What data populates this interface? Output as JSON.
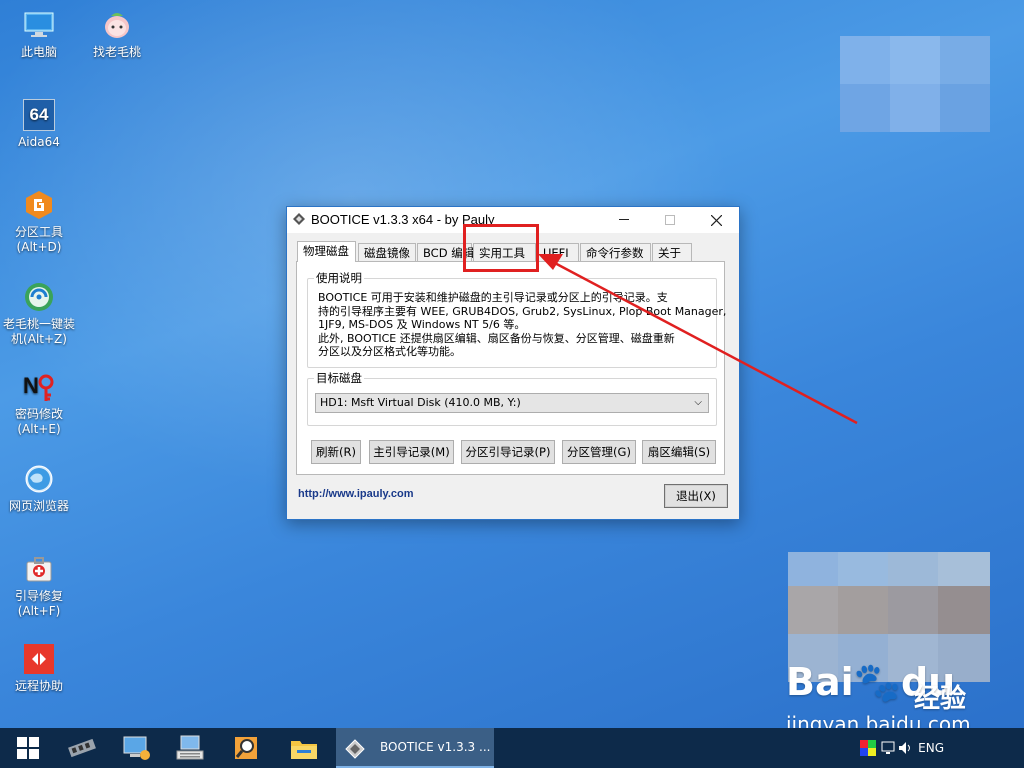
{
  "desktop": {
    "icons": [
      {
        "label": "此电脑",
        "icon": "this-pc-icon"
      },
      {
        "label": "找老毛桃",
        "icon": "peach-icon"
      },
      {
        "label": "Aida64",
        "icon": "aida64-icon",
        "glyph": "64"
      },
      {
        "label": "分区工具\n(Alt+D)",
        "icon": "partition-tool-icon"
      },
      {
        "label": "老毛桃一键装\n机(Alt+Z)",
        "icon": "one-click-install-icon"
      },
      {
        "label": "密码修改\n(Alt+E)",
        "icon": "password-change-icon"
      },
      {
        "label": "网页浏览器",
        "icon": "web-browser-icon"
      },
      {
        "label": "引导修复\n(Alt+F)",
        "icon": "boot-repair-icon"
      },
      {
        "label": "远程协助",
        "icon": "remote-assist-icon"
      }
    ]
  },
  "window": {
    "title": "BOOTICE v1.3.3 x64 - by Pauly",
    "tabs": [
      {
        "label": "物理磁盘",
        "active": true
      },
      {
        "label": "磁盘镜像"
      },
      {
        "label": "BCD 编辑"
      },
      {
        "label": "实用工具"
      },
      {
        "label": "UEFI"
      },
      {
        "label": "命令行参数"
      },
      {
        "label": "关于"
      }
    ],
    "usage": {
      "legend": "使用说明",
      "lines": [
        "BOOTICE 可用于安装和维护磁盘的主引导记录或分区上的引导记录。支",
        "持的引导程序主要有 WEE, GRUB4DOS, Grub2, SysLinux, Plop Boot Manager,",
        "1JF9, MS-DOS 及 Windows NT 5/6 等。",
        "此外, BOOTICE 还提供扇区编辑、扇区备份与恢复、分区管理、磁盘重新",
        "分区以及分区格式化等功能。"
      ]
    },
    "target": {
      "legend": "目标磁盘",
      "selected": "HD1: Msft Virtual Disk (410.0 MB, Y:)"
    },
    "buttons": {
      "refresh": "刷新(R)",
      "mbr": "主引导记录(M)",
      "pbr": "分区引导记录(P)",
      "parts": "分区管理(G)",
      "sector": "扇区编辑(S)",
      "exit": "退出(X)"
    },
    "link": "http://www.ipauly.com"
  },
  "taskbar": {
    "active_task": "BOOTICE v1.3.3 ...",
    "lang": "ENG"
  },
  "watermark": {
    "brand": "Bai🐾du",
    "jingyan": "经验",
    "url": "jingyan.baidu.com"
  },
  "colors": {
    "annotation": "#e02020",
    "desktop_blue": "#3a86db",
    "taskbar": "#0d2a4a"
  }
}
